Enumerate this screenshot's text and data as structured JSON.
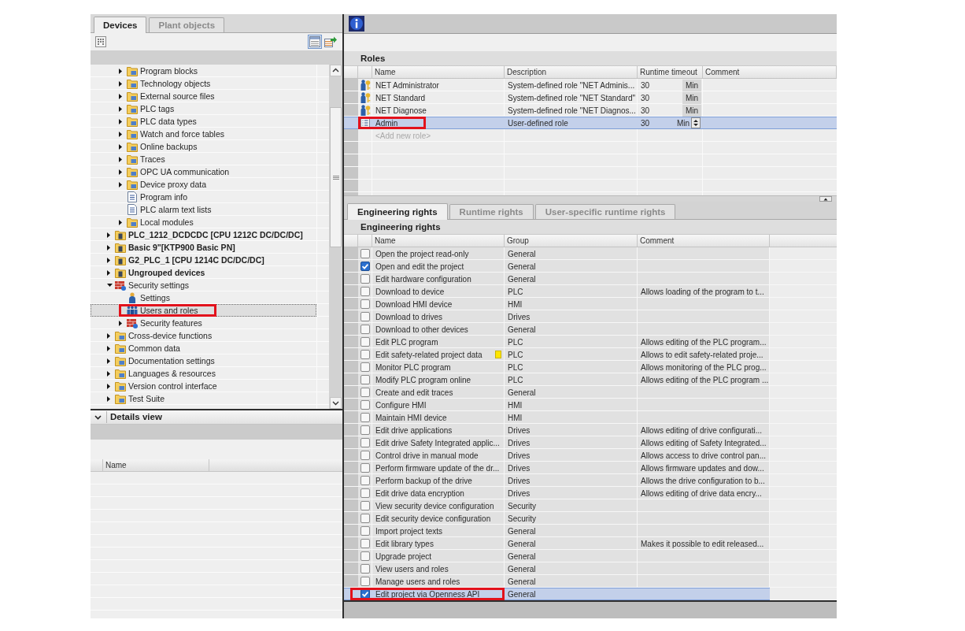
{
  "project_tree": {
    "tabs": [
      {
        "label": "Devices",
        "selected": true
      },
      {
        "label": "Plant objects",
        "selected": false
      }
    ],
    "toolbar": [
      {
        "kind": "overview",
        "selected": false
      },
      {
        "kind": "list",
        "selected": true
      },
      {
        "kind": "export",
        "selected": false
      }
    ],
    "items": [
      {
        "children": [
          {
            "label": "Program blocks",
            "kind": "folder",
            "expandable": true,
            "expanded": false,
            "selected": false,
            "highlighted": false
          },
          {
            "label": "Technology objects",
            "kind": "folder",
            "expandable": true,
            "expanded": false,
            "selected": false,
            "highlighted": false
          },
          {
            "label": "External source files",
            "kind": "folder",
            "expandable": true,
            "expanded": false,
            "selected": false,
            "highlighted": false
          },
          {
            "label": "PLC tags",
            "kind": "folder",
            "expandable": true,
            "expanded": false,
            "selected": false,
            "highlighted": false
          },
          {
            "label": "PLC data types",
            "kind": "folder",
            "expandable": true,
            "expanded": false,
            "selected": false,
            "highlighted": false
          },
          {
            "label": "Watch and force tables",
            "kind": "folder",
            "expandable": true,
            "expanded": false,
            "selected": false,
            "highlighted": false
          },
          {
            "label": "Online backups",
            "kind": "folder",
            "expandable": true,
            "expanded": false,
            "selected": false,
            "highlighted": false
          },
          {
            "label": "Traces",
            "kind": "folder",
            "expandable": true,
            "expanded": false,
            "selected": false,
            "highlighted": false
          },
          {
            "label": "OPC UA communication",
            "kind": "folder",
            "expandable": true,
            "expanded": false,
            "selected": false,
            "highlighted": false
          },
          {
            "label": "Device proxy data",
            "kind": "folder",
            "expandable": true,
            "expanded": false,
            "selected": false,
            "highlighted": false
          },
          {
            "label": "Program info",
            "kind": "document",
            "expandable": false,
            "expanded": false,
            "selected": false,
            "highlighted": false
          },
          {
            "label": "PLC alarm text lists",
            "kind": "document",
            "expandable": false,
            "expanded": false,
            "selected": false,
            "highlighted": false
          },
          {
            "label": "Local modules",
            "kind": "folder",
            "expandable": true,
            "expanded": false,
            "selected": false,
            "highlighted": false
          }
        ]
      },
      {
        "label": "PLC_1212_DCDCDC [CPU 1212C DC/DC/DC]",
        "kind": "device",
        "expandable": true,
        "expanded": false,
        "selected": false,
        "highlighted": false
      },
      {
        "label": "Basic 9\"[KTP900 Basic PN]",
        "kind": "device",
        "expandable": true,
        "expanded": false,
        "selected": false,
        "highlighted": false
      },
      {
        "label": "G2_PLC_1 [CPU 1214C DC/DC/DC]",
        "kind": "device",
        "expandable": true,
        "expanded": false,
        "selected": false,
        "highlighted": false
      },
      {
        "label": "Ungrouped devices",
        "kind": "device",
        "expandable": true,
        "expanded": false,
        "selected": false,
        "highlighted": false
      },
      {
        "label": "Security settings",
        "kind": "security",
        "expandable": true,
        "expanded": true,
        "selected": false,
        "highlighted": false,
        "children": [
          {
            "label": "Settings",
            "kind": "person",
            "expandable": false,
            "expanded": false,
            "selected": false,
            "highlighted": false
          },
          {
            "label": "Users and roles",
            "kind": "people",
            "expandable": false,
            "expanded": false,
            "selected": true,
            "highlighted": true
          },
          {
            "label": "Security features",
            "kind": "security",
            "expandable": true,
            "expanded": false,
            "selected": false,
            "highlighted": false
          }
        ]
      },
      {
        "label": "Cross-device functions",
        "kind": "folder",
        "expandable": true,
        "expanded": false,
        "selected": false,
        "highlighted": false
      },
      {
        "label": "Common data",
        "kind": "folder",
        "expandable": true,
        "expanded": false,
        "selected": false,
        "highlighted": false
      },
      {
        "label": "Documentation settings",
        "kind": "folder",
        "expandable": true,
        "expanded": false,
        "selected": false,
        "highlighted": false
      },
      {
        "label": "Languages & resources",
        "kind": "folder",
        "expandable": true,
        "expanded": false,
        "selected": false,
        "highlighted": false
      },
      {
        "label": "Version control interface",
        "kind": "folder",
        "expandable": true,
        "expanded": false,
        "selected": false,
        "highlighted": false
      },
      {
        "label": "Test Suite",
        "kind": "folder",
        "expandable": true,
        "expanded": false,
        "selected": false,
        "highlighted": false
      }
    ]
  },
  "details_view": {
    "title": "Details view",
    "expanded": true,
    "columns": [
      "Name"
    ]
  },
  "inspector": {
    "roles": {
      "title": "Roles",
      "columns": [
        "Name",
        "Description",
        "Runtime timeout",
        "Comment"
      ],
      "rows": [
        {
          "kind": "system",
          "name": "NET Administrator",
          "description": "System-defined role \"NET Adminis...",
          "timeout": "30",
          "unit": "Min",
          "selected": false,
          "highlighted": false
        },
        {
          "kind": "system",
          "name": "NET Standard",
          "description": "System-defined role \"NET Standard\"",
          "timeout": "30",
          "unit": "Min",
          "selected": false,
          "highlighted": false
        },
        {
          "kind": "system",
          "name": "NET Diagnose",
          "description": "System-defined role \"NET Diagnos...",
          "timeout": "30",
          "unit": "Min",
          "selected": false,
          "highlighted": false
        },
        {
          "kind": "custom",
          "name": "Admin",
          "description": "User-defined role",
          "timeout": "30",
          "unit": "Min",
          "selected": true,
          "highlighted": true
        }
      ],
      "new_row": {
        "placeholder": "<Add new role>"
      }
    },
    "tabs": [
      {
        "label": "Engineering rights",
        "selected": true
      },
      {
        "label": "Runtime rights",
        "selected": false
      },
      {
        "label": "User-specific runtime rights",
        "selected": false
      }
    ],
    "rights": {
      "title": "Engineering rights",
      "columns": [
        "Name",
        "Group",
        "Comment"
      ],
      "rows": [
        {
          "name": "Open the project read-only",
          "group": "General",
          "checked": false,
          "selected": false,
          "highlighted": false,
          "safety_marker": false
        },
        {
          "name": "Open and edit the project",
          "group": "General",
          "checked": true,
          "selected": false,
          "highlighted": false,
          "safety_marker": false
        },
        {
          "name": "Edit hardware configuration",
          "group": "General",
          "checked": false,
          "selected": false,
          "highlighted": false,
          "safety_marker": false
        },
        {
          "name": "Download to device",
          "group": "PLC",
          "comment": "Allows loading of the program to t...",
          "checked": false,
          "selected": false,
          "highlighted": false,
          "safety_marker": false
        },
        {
          "name": "Download HMI device",
          "group": "HMI",
          "checked": false,
          "selected": false,
          "highlighted": false,
          "safety_marker": false
        },
        {
          "name": "Download to drives",
          "group": "Drives",
          "checked": false,
          "selected": false,
          "highlighted": false,
          "safety_marker": false
        },
        {
          "name": "Download to other devices",
          "group": "General",
          "checked": false,
          "selected": false,
          "highlighted": false,
          "safety_marker": false
        },
        {
          "name": "Edit PLC program",
          "group": "PLC",
          "comment": "Allows editing of the PLC program...",
          "checked": false,
          "selected": false,
          "highlighted": false,
          "safety_marker": false
        },
        {
          "name": "Edit safety-related project data",
          "group": "PLC",
          "comment": "Allows to edit safety-related proje...",
          "checked": false,
          "selected": false,
          "highlighted": false,
          "safety_marker": true
        },
        {
          "name": "Monitor PLC program",
          "group": "PLC",
          "comment": "Allows monitoring of the PLC prog...",
          "checked": false,
          "selected": false,
          "highlighted": false,
          "safety_marker": false
        },
        {
          "name": "Modify PLC program online",
          "group": "PLC",
          "comment": "Allows editing of the PLC program ...",
          "checked": false,
          "selected": false,
          "highlighted": false,
          "safety_marker": false
        },
        {
          "name": "Create and edit traces",
          "group": "General",
          "checked": false,
          "selected": false,
          "highlighted": false,
          "safety_marker": false
        },
        {
          "name": "Configure HMI",
          "group": "HMI",
          "checked": false,
          "selected": false,
          "highlighted": false,
          "safety_marker": false
        },
        {
          "name": "Maintain HMI device",
          "group": "HMI",
          "checked": false,
          "selected": false,
          "highlighted": false,
          "safety_marker": false
        },
        {
          "name": "Edit drive applications",
          "group": "Drives",
          "comment": "Allows editing of drive configurati...",
          "checked": false,
          "selected": false,
          "highlighted": false,
          "safety_marker": false
        },
        {
          "name": "Edit drive Safety Integrated applic...",
          "group": "Drives",
          "comment": "Allows editing of Safety Integrated...",
          "checked": false,
          "selected": false,
          "highlighted": false,
          "safety_marker": false
        },
        {
          "name": "Control drive in manual mode",
          "group": "Drives",
          "comment": "Allows access to drive control pan...",
          "checked": false,
          "selected": false,
          "highlighted": false,
          "safety_marker": false
        },
        {
          "name": "Perform firmware update of the dr...",
          "group": "Drives",
          "comment": "Allows firmware updates and dow...",
          "checked": false,
          "selected": false,
          "highlighted": false,
          "safety_marker": false
        },
        {
          "name": "Perform backup of the drive",
          "group": "Drives",
          "comment": "Allows the drive configuration to b...",
          "checked": false,
          "selected": false,
          "highlighted": false,
          "safety_marker": false
        },
        {
          "name": "Edit drive data encryption",
          "group": "Drives",
          "comment": "Allows editing of drive data encry...",
          "checked": false,
          "selected": false,
          "highlighted": false,
          "safety_marker": false
        },
        {
          "name": "View security device configuration",
          "group": "Security",
          "checked": false,
          "selected": false,
          "highlighted": false,
          "safety_marker": false
        },
        {
          "name": "Edit security device configuration",
          "group": "Security",
          "checked": false,
          "selected": false,
          "highlighted": false,
          "safety_marker": false
        },
        {
          "name": "Import project texts",
          "group": "General",
          "checked": false,
          "selected": false,
          "highlighted": false,
          "safety_marker": false
        },
        {
          "name": "Edit library types",
          "group": "General",
          "comment": "Makes it possible to edit released...",
          "checked": false,
          "selected": false,
          "highlighted": false,
          "safety_marker": false
        },
        {
          "name": "Upgrade project",
          "group": "General",
          "checked": false,
          "selected": false,
          "highlighted": false,
          "safety_marker": false
        },
        {
          "name": "View users and roles",
          "group": "General",
          "checked": false,
          "selected": false,
          "highlighted": false,
          "safety_marker": false
        },
        {
          "name": "Manage users and roles",
          "group": "General",
          "checked": false,
          "selected": false,
          "highlighted": false,
          "safety_marker": false
        },
        {
          "name": "Edit project via Openness API",
          "group": "General",
          "checked": true,
          "selected": true,
          "highlighted": true,
          "safety_marker": false
        }
      ]
    }
  }
}
